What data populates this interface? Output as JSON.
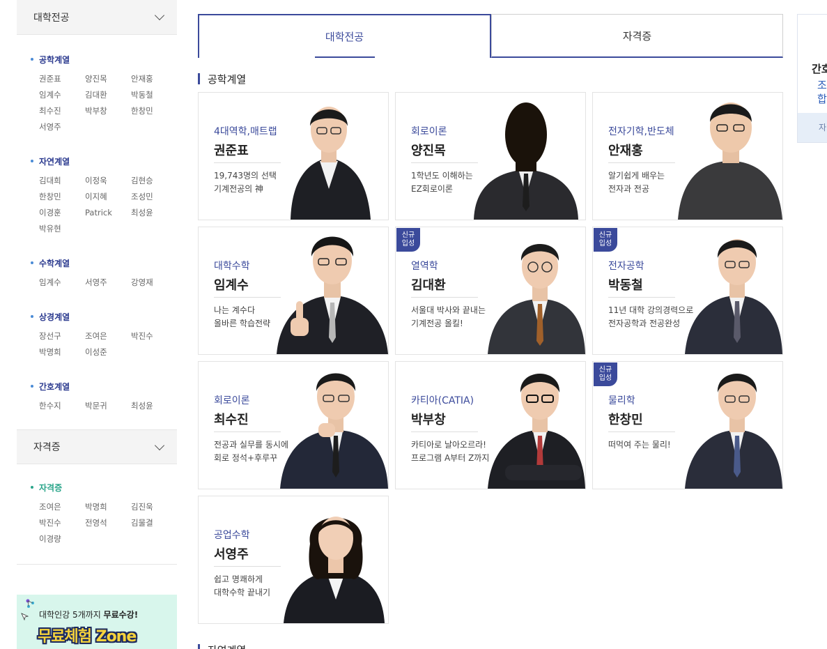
{
  "sidebar": {
    "major_heading": "대학전공",
    "license_heading": "자격증",
    "groups": [
      {
        "title": "공학계열",
        "names": [
          "권준표",
          "양진목",
          "안재홍",
          "임계수",
          "김대환",
          "박동철",
          "최수진",
          "박부창",
          "한창민",
          "서영주"
        ]
      },
      {
        "title": "자연계열",
        "names": [
          "김대희",
          "이정욱",
          "김현승",
          "한창민",
          "이지혜",
          "조성민",
          "이경훈",
          "Patrick",
          "최성윤",
          "박유현"
        ]
      },
      {
        "title": "수학계열",
        "names": [
          "임계수",
          "서영주",
          "강영재"
        ]
      },
      {
        "title": "상경계열",
        "names": [
          "장선구",
          "조여은",
          "박진수",
          "박명희",
          "이성준"
        ]
      },
      {
        "title": "간호계열",
        "names": [
          "한수지",
          "박문귀",
          "최성윤"
        ]
      }
    ],
    "license_group": {
      "title": "자격증",
      "names": [
        "조여은",
        "박명희",
        "김진욱",
        "박진수",
        "전영석",
        "김물결",
        "이경량"
      ]
    }
  },
  "banner": {
    "line1_prefix": "대학인강 5개까지 ",
    "line1_bold": "무료수강!",
    "line2": "무료체험 Zone"
  },
  "tabs": [
    {
      "label": "대학전공"
    },
    {
      "label": "자격증"
    }
  ],
  "section": {
    "title": "공학계열",
    "next_title": "자연계열"
  },
  "badge_text": {
    "l1": "신규",
    "l2": "입성"
  },
  "cards": [
    {
      "subject": "4대역학,매트랩",
      "name": "권준표",
      "desc1": "19,743명의 선택",
      "desc2": "기계전공의 神"
    },
    {
      "subject": "회로이론",
      "name": "양진목",
      "desc1": "1학년도 이해하는",
      "desc2": "EZ회로이론"
    },
    {
      "subject": "전자기학,반도체",
      "name": "안재홍",
      "desc1": "알기쉽게 배우는",
      "desc2": "전자과 전공"
    },
    {
      "subject": "대학수학",
      "name": "임계수",
      "desc1": "나는 계수다",
      "desc2": "올바른 학습전략"
    },
    {
      "subject": "열역학",
      "name": "김대환",
      "desc1": "서울대 박사와 끝내는",
      "desc2": "기계전공 올킬!"
    },
    {
      "subject": "전자공학",
      "name": "박동철",
      "desc1": "11년 대학 강의경력으로",
      "desc2": "전자공학과 전공완성"
    },
    {
      "subject": "회로이론",
      "name": "최수진",
      "desc1": "전공과 실무를 동시에",
      "desc2": "회로 정석+후루꾸"
    },
    {
      "subject": "카티아(CATIA)",
      "name": "박부창",
      "desc1": "카티아로 날아오르라!",
      "desc2": "프로그램 A부터 Z까지"
    },
    {
      "subject": "물리학",
      "name": "한창민",
      "desc1": "떠먹여 주는 물리!",
      "desc2": ""
    },
    {
      "subject": "공업수학",
      "name": "서영주",
      "desc1": "쉽고 명쾌하게",
      "desc2": "대학수학 끝내기"
    }
  ],
  "right_panel": {
    "t1": "간호",
    "t2": "조",
    "t3": "합",
    "foot": "자"
  }
}
